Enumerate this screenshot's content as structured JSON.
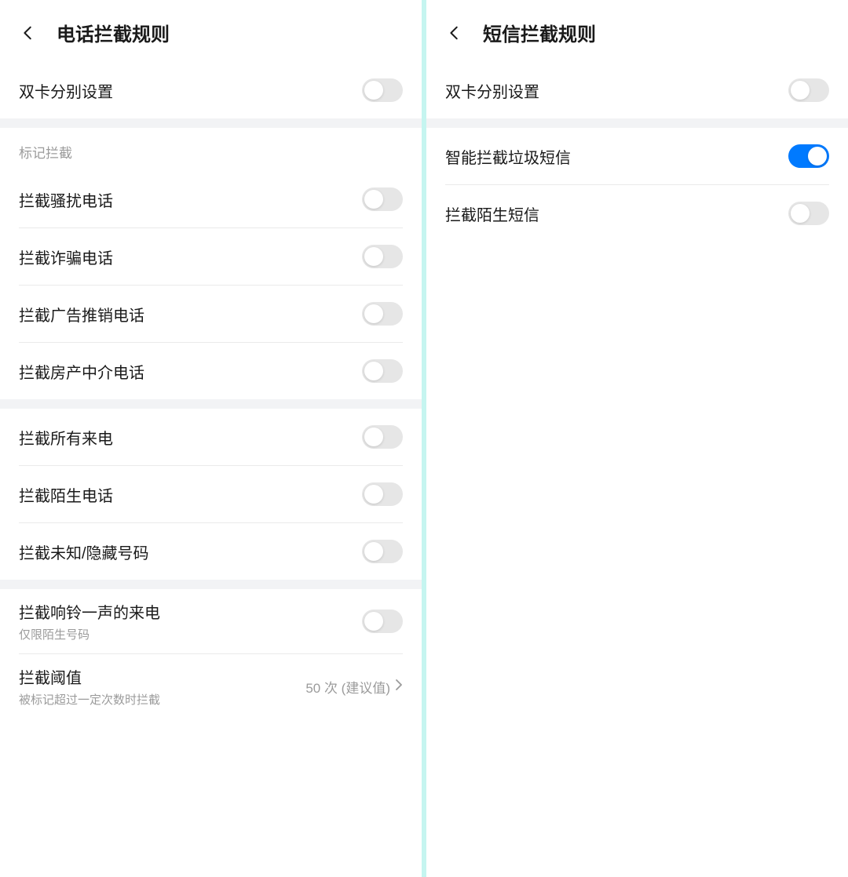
{
  "left": {
    "title": "电话拦截规则",
    "dual_sim": {
      "label": "双卡分别设置",
      "on": false
    },
    "section1_header": "标记拦截",
    "section1": [
      {
        "label": "拦截骚扰电话",
        "on": false
      },
      {
        "label": "拦截诈骗电话",
        "on": false
      },
      {
        "label": "拦截广告推销电话",
        "on": false
      },
      {
        "label": "拦截房产中介电话",
        "on": false
      }
    ],
    "section2": [
      {
        "label": "拦截所有来电",
        "on": false
      },
      {
        "label": "拦截陌生电话",
        "on": false
      },
      {
        "label": "拦截未知/隐藏号码",
        "on": false
      }
    ],
    "section3": {
      "ring_once": {
        "label": "拦截响铃一声的来电",
        "sub": "仅限陌生号码",
        "on": false
      },
      "threshold": {
        "label": "拦截阈值",
        "sub": "被标记超过一定次数时拦截",
        "value": "50 次 (建议值)"
      }
    }
  },
  "right": {
    "title": "短信拦截规则",
    "dual_sim": {
      "label": "双卡分别设置",
      "on": false
    },
    "items": [
      {
        "label": "智能拦截垃圾短信",
        "on": true
      },
      {
        "label": "拦截陌生短信",
        "on": false
      }
    ]
  }
}
